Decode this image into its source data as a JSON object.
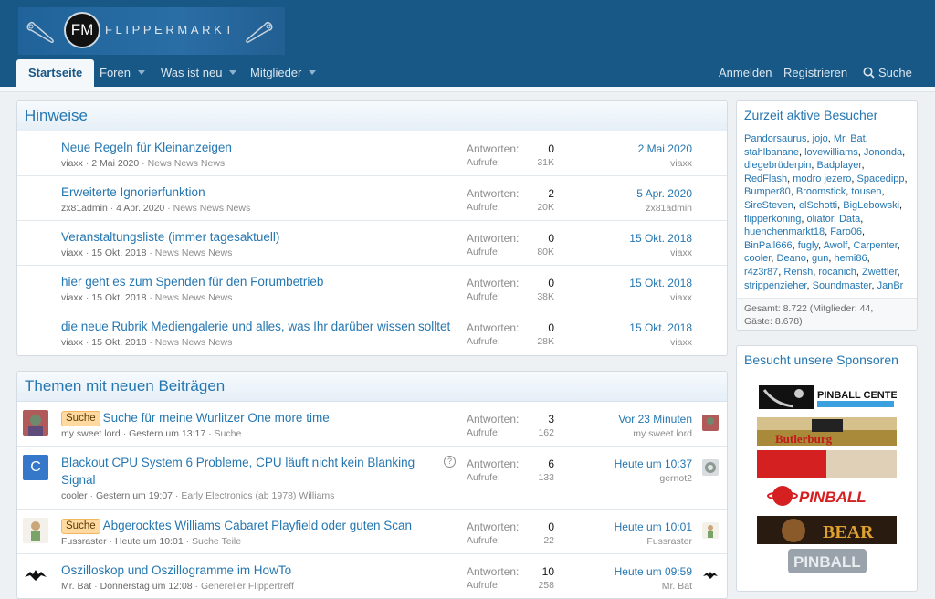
{
  "site": {
    "logo_initials": "FM",
    "logo_text": "FLIPPERMARKT"
  },
  "nav": {
    "tabs": [
      {
        "label": "Startseite"
      },
      {
        "label": "Foren"
      },
      {
        "label": "Was ist neu"
      },
      {
        "label": "Mitglieder"
      }
    ],
    "login": "Anmelden",
    "register": "Registrieren",
    "search": "Suche"
  },
  "colors": {
    "header": "#185886",
    "link": "#2577b1",
    "prefix_bg": "#ffd9a0"
  },
  "hinweise": {
    "title": "Hinweise",
    "rows": [
      {
        "title": "Neue Regeln für Kleinanzeigen",
        "user": "viaxx",
        "date": "2 Mai 2020",
        "forum": "News News News",
        "replies_label": "Antworten:",
        "replies": "0",
        "views_label": "Aufrufe:",
        "views": "31K",
        "last_date": "2 Mai 2020",
        "last_user": "viaxx"
      },
      {
        "title": "Erweiterte Ignorierfunktion",
        "user": "zx81admin",
        "date": "4 Apr. 2020",
        "forum": "News News News",
        "replies_label": "Antworten:",
        "replies": "2",
        "views_label": "Aufrufe:",
        "views": "20K",
        "last_date": "5 Apr. 2020",
        "last_user": "zx81admin"
      },
      {
        "title": "Veranstaltungsliste (immer tagesaktuell)",
        "user": "viaxx",
        "date": "15 Okt. 2018",
        "forum": "News News News",
        "replies_label": "Antworten:",
        "replies": "0",
        "views_label": "Aufrufe:",
        "views": "80K",
        "last_date": "15 Okt. 2018",
        "last_user": "viaxx"
      },
      {
        "title": "hier geht es zum Spenden für den Forumbetrieb",
        "user": "viaxx",
        "date": "15 Okt. 2018",
        "forum": "News News News",
        "replies_label": "Antworten:",
        "replies": "0",
        "views_label": "Aufrufe:",
        "views": "38K",
        "last_date": "15 Okt. 2018",
        "last_user": "viaxx"
      },
      {
        "title": "die neue Rubrik Mediengalerie und alles, was Ihr darüber wissen solltet",
        "user": "viaxx",
        "date": "15 Okt. 2018",
        "forum": "News News News",
        "replies_label": "Antworten:",
        "replies": "0",
        "views_label": "Aufrufe:",
        "views": "28K",
        "last_date": "15 Okt. 2018",
        "last_user": "viaxx"
      }
    ]
  },
  "themen": {
    "title": "Themen mit neuen Beiträgen",
    "rows": [
      {
        "prefix": "Suche",
        "title": "Suche für meine Wurlitzer One more time",
        "title2": "",
        "user": "my sweet lord",
        "date": "Gestern um 13:17",
        "forum": "Suche",
        "replies_label": "Antworten:",
        "replies": "3",
        "views_label": "Aufrufe:",
        "views": "162",
        "last_date": "Vor 23 Minuten",
        "last_user": "my sweet lord"
      },
      {
        "prefix": "",
        "title": "Blackout CPU System 6 Probleme, CPU läuft nicht kein Blanking",
        "title2": "Signal",
        "avatar_letter": "C",
        "question_icon": "?",
        "user": "cooler",
        "date": "Gestern um 19:07",
        "forum": "Early Electronics (ab 1978) Williams",
        "replies_label": "Antworten:",
        "replies": "6",
        "views_label": "Aufrufe:",
        "views": "133",
        "last_date": "Heute um 10:37",
        "last_user": "gernot2"
      },
      {
        "prefix": "Suche",
        "title": "Abgerocktes Williams Cabaret Playfield oder guten Scan",
        "title2": "",
        "user": "Fussraster",
        "date": "Heute um 10:01",
        "forum": "Suche Teile",
        "replies_label": "Antworten:",
        "replies": "0",
        "views_label": "Aufrufe:",
        "views": "22",
        "last_date": "Heute um 10:01",
        "last_user": "Fussraster"
      },
      {
        "prefix": "",
        "title": "Oszilloskop und Oszillogramme im HowTo",
        "title2": "",
        "user": "Mr. Bat",
        "date": "Donnerstag um 12:08",
        "forum": "Genereller Flippertreff",
        "replies_label": "Antworten:",
        "replies": "10",
        "views_label": "Aufrufe:",
        "views": "258",
        "last_date": "Heute um 09:59",
        "last_user": "Mr. Bat"
      }
    ]
  },
  "online": {
    "title": "Zurzeit aktive Besucher",
    "members": [
      "Pandorsaurus",
      "jojo",
      "Mr. Bat",
      "stahlbanane",
      "lovewilliams",
      "Jononda",
      "diegebrüderpin",
      "Badplayer",
      "RedFlash",
      "modro jezero",
      "Spacedipp",
      "Bumper80",
      "Broomstick",
      "tousen",
      "SireSteven",
      "elSchotti",
      "BigLebowski",
      "flipperkoning",
      "oliator",
      "Data",
      "huenchenmarkt18",
      "Faro06",
      "BinPall666",
      "fugly",
      "Awolf",
      "Carpenter",
      "cooler",
      "Deano",
      "gun",
      "hemi86",
      "r4z3r87",
      "Rensh",
      "rocanich",
      "Zwettler",
      "strippenzieher",
      "Soundmaster",
      "JanBr"
    ],
    "total_line1": "Gesamt: 8.722 (Mitglieder: 44,",
    "total_line2": "Gäste: 8.678)"
  },
  "sponsors": {
    "title": "Besucht unsere Sponsoren",
    "items": [
      {
        "name": "pinball-center-logo",
        "text": "PINBALL CENTER"
      },
      {
        "name": "butlerburg-logo",
        "text": "Butlerburg"
      },
      {
        "name": "red-banner-logo",
        "text": ""
      },
      {
        "name": "pinball-universe-logo",
        "text": "PINBALL"
      },
      {
        "name": "bear-banner-logo",
        "text": "BEAR"
      },
      {
        "name": "pinball-point-logo",
        "text": "PINBALL"
      }
    ]
  }
}
